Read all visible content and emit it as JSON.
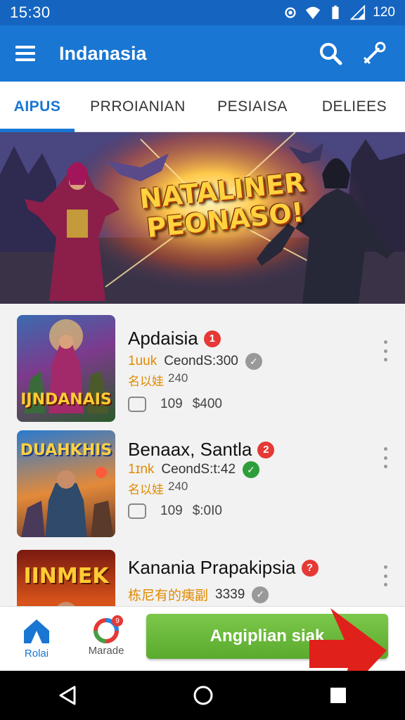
{
  "status_bar": {
    "time": "15:30",
    "battery_text": "120"
  },
  "app_bar": {
    "title": "Indanasia"
  },
  "tabs": [
    {
      "label": "AIPUS",
      "active": true
    },
    {
      "label": "PRROIANIAN"
    },
    {
      "label": "PESIAISA"
    },
    {
      "label": "DELIEES"
    }
  ],
  "banner": {
    "line1": "NATALINER",
    "line2": "PEONASO!"
  },
  "games": [
    {
      "title": "Apdaisia",
      "badge": "1",
      "meta1_tag": "1uuk",
      "meta1_text": "CeondS:300",
      "meta2_tag": "名以娃",
      "meta2_text": "240",
      "comments": "109",
      "price": "$400",
      "thumb_text": "IJNDANAIS",
      "verify": "gray"
    },
    {
      "title": "Benaax, Santla",
      "badge": "2",
      "meta1_tag": "1ɪnk",
      "meta1_text": "CeondS:t:42",
      "meta2_tag": "名以娃",
      "meta2_text": "240",
      "comments": "109",
      "price": "$:0I0",
      "thumb_text": "DUAHKHIS",
      "verify": "green"
    },
    {
      "title": "Kanania Prapakipsia",
      "badge": "?",
      "meta1_tag": "栋尼有的痍副",
      "meta1_text": "3339",
      "thumb_text": "IINMEK",
      "verify": "gray"
    }
  ],
  "bottom_nav": {
    "home_label": "Rolai",
    "center_label": "Marade",
    "center_badge": "9",
    "cta_label": "Angiplian siak"
  },
  "colors": {
    "primary": "#1976d2",
    "cta": "#6bbb3c",
    "badge": "#e53935",
    "accent_text": "#e08a00"
  }
}
